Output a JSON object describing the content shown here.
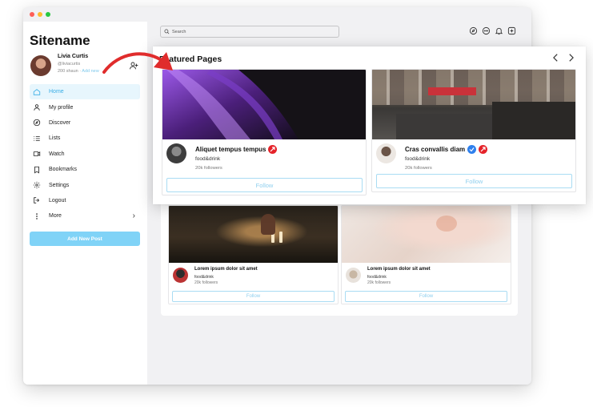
{
  "window_controls": {
    "close_color": "#fe5f57",
    "minimize_color": "#febc2e",
    "zoom_color": "#28c840"
  },
  "sidebar": {
    "sitename": "Sitename",
    "profile": {
      "name": "Livia Curtis",
      "handle": "@liviacurtis",
      "stats": "200 shaun",
      "stats_link": "Add new"
    },
    "items": [
      {
        "label": "Home",
        "icon": "home-icon",
        "active": true
      },
      {
        "label": "My profile",
        "icon": "user-icon"
      },
      {
        "label": "Discover",
        "icon": "compass-icon"
      },
      {
        "label": "Lists",
        "icon": "list-icon"
      },
      {
        "label": "Watch",
        "icon": "video-icon"
      },
      {
        "label": "Bookmarks",
        "icon": "bookmark-icon"
      },
      {
        "label": "Settings",
        "icon": "gear-icon"
      },
      {
        "label": "Logout",
        "icon": "logout-icon"
      },
      {
        "label": "More",
        "icon": "more-icon"
      }
    ],
    "add_post_label": "Add New Post"
  },
  "header": {
    "search_placeholder": "Search",
    "icons": [
      "compass-icon",
      "chat-icon",
      "bell-icon",
      "add-square-icon"
    ]
  },
  "featured": {
    "title": "Featured Pages",
    "cards": [
      {
        "title": "Aliquet tempus tempus",
        "category": "food&drink",
        "followers": "20k followers",
        "follow_label": "Follow",
        "verified": false
      },
      {
        "title": "Cras convallis diam",
        "category": "food&drink",
        "followers": "20k followers",
        "follow_label": "Follow",
        "verified": true
      }
    ]
  },
  "feed": {
    "cards": [
      {
        "title": "Lorem ipsum dolor sit amet",
        "category": "food&drink",
        "followers": "20k followers",
        "follow_label": "Follow"
      },
      {
        "title": "Lorem ipsum dolor sit amet",
        "category": "food&drink",
        "followers": "20k followers",
        "follow_label": "Follow"
      }
    ]
  },
  "colors": {
    "accent": "#39aee6",
    "button_fill": "#80d3f7",
    "follow_border": "#a9dcf3",
    "badge_red": "#e5232a",
    "badge_blue": "#2f80ed"
  }
}
